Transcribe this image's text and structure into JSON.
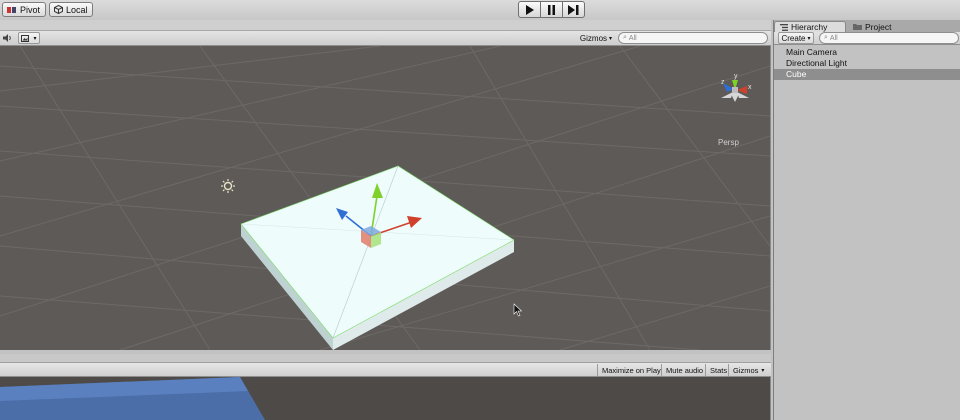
{
  "toolbar": {
    "pivot_label": "Pivot",
    "local_label": "Local",
    "play_icon": "play-icon",
    "pause_icon": "pause-icon",
    "step_icon": "step-icon"
  },
  "scene": {
    "gizmos_label": "Gizmos",
    "search_placeholder": "All",
    "persp_label": "Persp",
    "axis_labels": {
      "y": "y",
      "x": "x",
      "z": "z"
    },
    "colors": {
      "background": "#5e5a58",
      "plane": "#eefcfc",
      "x_axis": "#d0412c",
      "y_axis": "#7fd12a",
      "z_axis": "#2f6fd6"
    }
  },
  "game": {
    "buttons": [
      "Maximize on Play",
      "Mute audio",
      "Stats",
      "Gizmos"
    ]
  },
  "hierarchy": {
    "tab_hierarchy": "Hierarchy",
    "tab_project": "Project",
    "create_label": "Create",
    "search_placeholder": "All",
    "items": [
      {
        "label": "Main Camera"
      },
      {
        "label": "Directional Light"
      },
      {
        "label": "Cube"
      }
    ],
    "selected_index": 2
  }
}
